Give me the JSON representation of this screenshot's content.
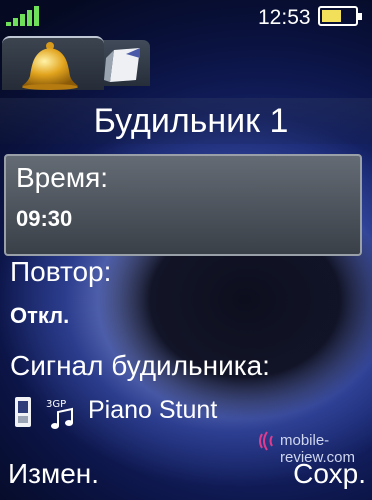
{
  "status_bar": {
    "time": "12:53",
    "battery_level": 0.6,
    "signal_bars": 5
  },
  "tabs": [
    {
      "name": "alarm-bell-icon",
      "selected": true
    },
    {
      "name": "note-icon",
      "selected": false
    }
  ],
  "title": "Будильник 1",
  "fields": {
    "time_label": "Время:",
    "time_value": "09:30",
    "repeat_label": "Повтор:",
    "repeat_value": "Откл.",
    "signal_label": "Сигнал будильника:",
    "signal_value": "Piano Stunt",
    "signal_icons": [
      "phone-memory-icon",
      "3gp-music-icon"
    ],
    "signal_icon_text": "3GP"
  },
  "softkeys": {
    "left": "Измен.",
    "right": "Сохр."
  },
  "watermark": "mobile-review.com",
  "colors": {
    "signal_green": "#6fe05a",
    "battery_yellow": "#f2e05a",
    "selection_grey": "#5a6068"
  }
}
